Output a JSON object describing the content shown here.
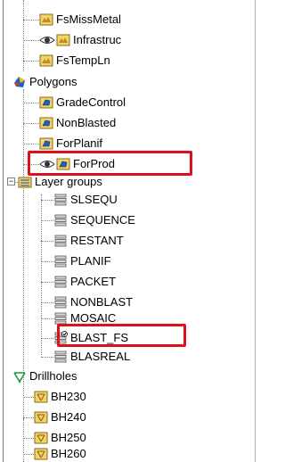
{
  "tree": {
    "raster_items": [
      {
        "label": "FsMissMetal",
        "visible": false
      },
      {
        "label": "Infrastruc",
        "visible": true
      },
      {
        "label": "FsTempLn",
        "visible": false
      }
    ],
    "polygons_group": {
      "label": "Polygons",
      "items": [
        {
          "label": "GradeControl",
          "visible": false
        },
        {
          "label": "NonBlasted",
          "visible": false
        },
        {
          "label": "ForPlanif",
          "visible": false
        },
        {
          "label": "ForProd",
          "visible": true,
          "highlighted": true
        }
      ]
    },
    "layer_groups": {
      "label": "Layer groups",
      "expander": "−",
      "items": [
        {
          "label": "SLSEQU"
        },
        {
          "label": "SEQUENCE"
        },
        {
          "label": "RESTANT"
        },
        {
          "label": "PLANIF"
        },
        {
          "label": "PACKET"
        },
        {
          "label": "NONBLAST"
        },
        {
          "label": "MOSAIC"
        },
        {
          "label": "BLAST_FS",
          "highlighted": true,
          "checked": true
        },
        {
          "label": "BLASREAL"
        }
      ]
    },
    "drillholes_group": {
      "label": "Drillholes",
      "items": [
        {
          "label": "BH230"
        },
        {
          "label": "BH240"
        },
        {
          "label": "BH250"
        },
        {
          "label": "BH260"
        }
      ]
    }
  },
  "colors": {
    "highlight_box": "#e0101a",
    "folder_yellow": "#f2d46a",
    "polygon_blue": "#1f5fc2"
  }
}
